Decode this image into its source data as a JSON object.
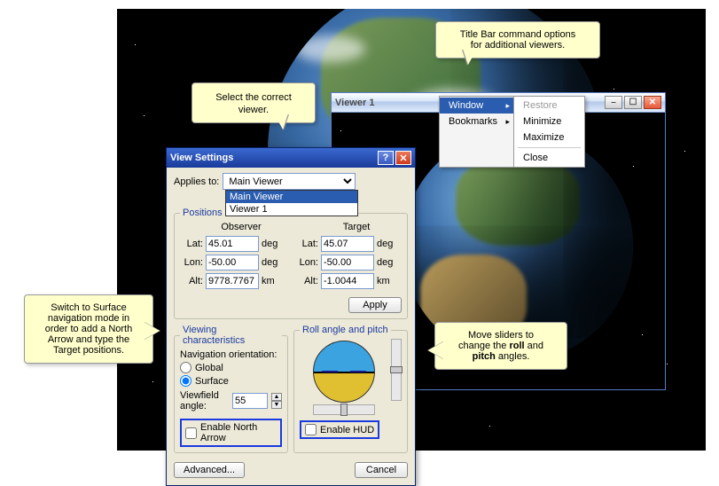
{
  "viewer": {
    "title": "Viewer 1"
  },
  "menu": {
    "col1": [
      "Window",
      "Bookmarks"
    ],
    "col2": [
      "Restore",
      "Minimize",
      "Maximize",
      "Close"
    ]
  },
  "dialog": {
    "title": "View Settings",
    "applies_label": "Applies to:",
    "applies_value": "Main Viewer",
    "applies_options": [
      "Main Viewer",
      "Viewer 1"
    ],
    "positions": {
      "legend": "Positions",
      "observer_label": "Observer",
      "target_label": "Target",
      "rows": {
        "lat": "Lat:",
        "lon": "Lon:",
        "alt": "Alt:"
      },
      "units": {
        "deg": "deg",
        "km": "km"
      },
      "observer": {
        "lat": "45.01",
        "lon": "-50.00",
        "alt": "9778.7767"
      },
      "target": {
        "lat": "45.07",
        "lon": "-50.00",
        "alt": "-1.0044"
      },
      "apply": "Apply"
    },
    "viewing": {
      "legend": "Viewing characteristics",
      "nav_label": "Navigation orientation:",
      "global": "Global",
      "surface": "Surface",
      "viewfield_label": "Viewfield angle:",
      "viewfield_value": "55",
      "north_arrow": "Enable North Arrow"
    },
    "roll": {
      "legend": "Roll angle and pitch",
      "hud": "Enable HUD"
    },
    "advanced": "Advanced...",
    "cancel": "Cancel"
  },
  "callouts": {
    "c1": "Select the correct viewer.",
    "c2_a": "Title Bar command options",
    "c2_b": "for additional viewers.",
    "c3_a": "Switch to Surface",
    "c3_b": "navigation mode in",
    "c3_c": "order to add a North",
    "c3_d": "Arrow and type the",
    "c3_e": "Target positions.",
    "c4_a": "Move sliders to",
    "c4_b1": "change the ",
    "c4_b2": "roll",
    "c4_b3": " and",
    "c4_c1": "pitch",
    "c4_c2": " angles."
  }
}
